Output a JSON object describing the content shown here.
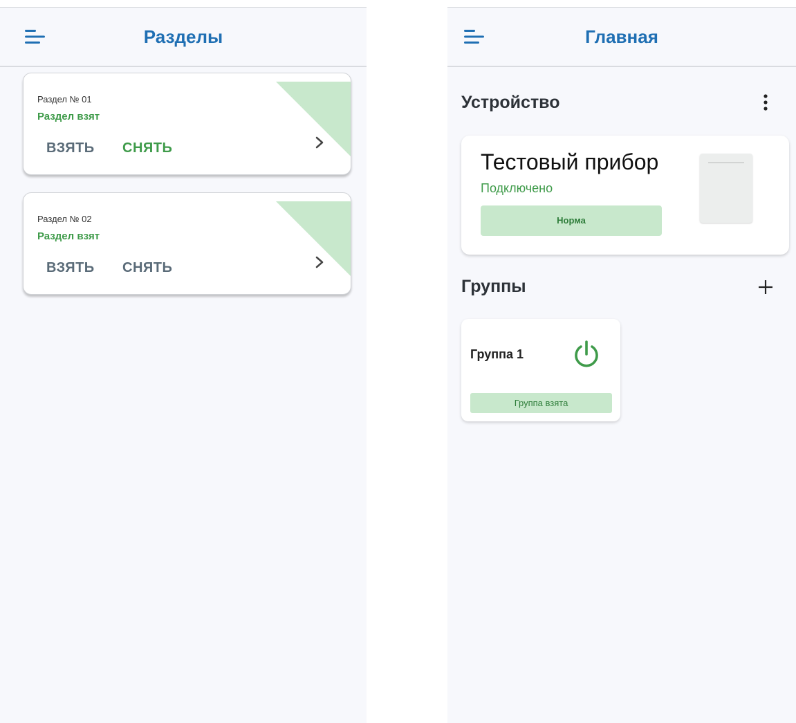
{
  "colors": {
    "title_blue": "#1f6fb3",
    "status_green": "#3f9b4a",
    "green_fill": "#c8e8cc",
    "button_gray": "#5a6b78",
    "background": "#f7f8fc"
  },
  "sections_screen": {
    "title": "Разделы",
    "menu_icon": "menu-icon",
    "sections": [
      {
        "number": "Раздел № 01",
        "status": "Раздел взят",
        "arm_label": "ВЗЯТЬ",
        "disarm_label": "СНЯТЬ",
        "disarm_highlighted": true
      },
      {
        "number": "Раздел № 02",
        "status": "Раздел взят",
        "arm_label": "ВЗЯТЬ",
        "disarm_label": "СНЯТЬ",
        "disarm_highlighted": false
      }
    ]
  },
  "main_screen": {
    "title": "Главная",
    "menu_icon": "menu-icon",
    "device_heading": "Устройство",
    "device": {
      "name": "Тестовый прибор",
      "connection": "Подключено",
      "state": "Норма",
      "image_icon": "device-image"
    },
    "groups_heading": "Группы",
    "groups": [
      {
        "name": "Группа 1",
        "status": "Группа взята",
        "icon": "power-icon"
      }
    ]
  }
}
